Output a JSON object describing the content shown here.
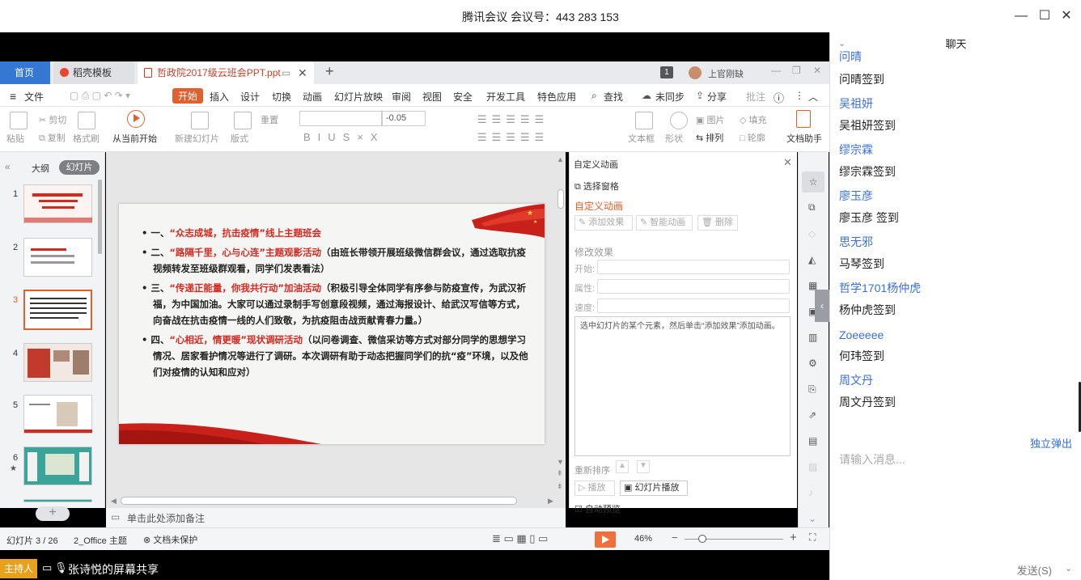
{
  "window": {
    "title": "腾讯会议 会议号：443 283 153"
  },
  "tabs": {
    "home": "首页",
    "template": "稻壳模板",
    "doc": "哲政院2017级云班会PPT.ppt",
    "page_badge": "1",
    "user": "上官刚缺"
  },
  "menu": [
    "文件",
    "开始",
    "插入",
    "设计",
    "切换",
    "动画",
    "幻灯片放映",
    "审阅",
    "视图",
    "安全",
    "开发工具",
    "特色应用",
    "查找",
    "未同步",
    "分享",
    "批注"
  ],
  "ribbon": {
    "paste": "粘贴",
    "cut": "剪切",
    "copy": "复制",
    "format_painter": "格式刷",
    "from_current": "从当前开始",
    "new_slide": "新建幻灯片",
    "layout": "版式",
    "reset": "重置",
    "font_size": "-0.05",
    "textbox": "文本框",
    "shape": "形状",
    "arrange": "排列",
    "picture": "图片",
    "fill": "填充",
    "outline": "轮廓",
    "doc_assistant": "文档助手"
  },
  "left_pane": {
    "outline_tab": "大纲",
    "slides_tab": "幻灯片",
    "numbers": [
      "1",
      "2",
      "3",
      "4",
      "5",
      "6"
    ]
  },
  "slide": {
    "items": [
      {
        "num": "一、",
        "red": "“众志成城，抗击疫情”线上主题班会",
        "black": ""
      },
      {
        "num": "二、",
        "red": "“路隔千里，心与心连”主题观影活动",
        "black": "（由班长带领开展班级微信群会议，通过选取抗疫视频转发至班级群观看，同学们发表看法）"
      },
      {
        "num": "三、",
        "red": "“传递正能量，你我共行动”加油活动",
        "black": "（积极引导全体同学有序参与防疫宣传，为武汉祈福，为中国加油。大家可以通过录制手写创意段视频，通过海报设计、给武汉写信等方式，向奋战在抗击疫情一线的人们致敬，为抗疫阻击战贡献青春力量。）"
      },
      {
        "num": "四、",
        "red": "“心相近，情更暖”现状调研活动",
        "black": "（以问卷调查、微信采访等方式对部分同学的思想学习情况、居家看护情况等进行了调研。本次调研有助于动态把握同学们的抗“疫”环境，以及他们对疫情的认知和应对）"
      }
    ]
  },
  "right_pane": {
    "title": "自定义动画",
    "select_pane": "选择窗格",
    "section": "自定义动画",
    "add_effect": "添加效果",
    "smart_anim": "智能动画",
    "delete": "删除",
    "modify": "修改效果",
    "start": "开始:",
    "property": "属性:",
    "speed": "速度:",
    "hint": "选中幻灯片的某个元素，然后单击“添加效果”添加动画。",
    "reorder": "重新排序",
    "play": "播放",
    "slideshow": "幻灯片播放",
    "autopreview": "自动预览"
  },
  "notes": {
    "placeholder": "单击此处添加备注"
  },
  "status": {
    "slide": "幻灯片 3 / 26",
    "theme": "2_Office 主题",
    "protect": "文档未保护",
    "zoom": "46%"
  },
  "share": {
    "host": "主持人",
    "text": "张诗悦的屏幕共享"
  },
  "chat": {
    "title": "聊天",
    "messages": [
      {
        "name": "问晴",
        "text": "问晴签到"
      },
      {
        "name": "吴祖妍",
        "text": "吴祖妍签到"
      },
      {
        "name": "缪宗霖",
        "text": "缪宗霖签到"
      },
      {
        "name": "廖玉彦",
        "text": "廖玉彦 签到"
      },
      {
        "name": "思无邪",
        "text": "马琴签到"
      },
      {
        "name": "哲学1701杨仲虎",
        "text": "杨仲虎签到"
      },
      {
        "name": "Zoeeeee",
        "text": "何玮签到"
      },
      {
        "name": "周文丹",
        "text": "周文丹签到"
      }
    ],
    "popout": "独立弹出",
    "placeholder": "请输入消息...",
    "send": "发送(S)"
  }
}
